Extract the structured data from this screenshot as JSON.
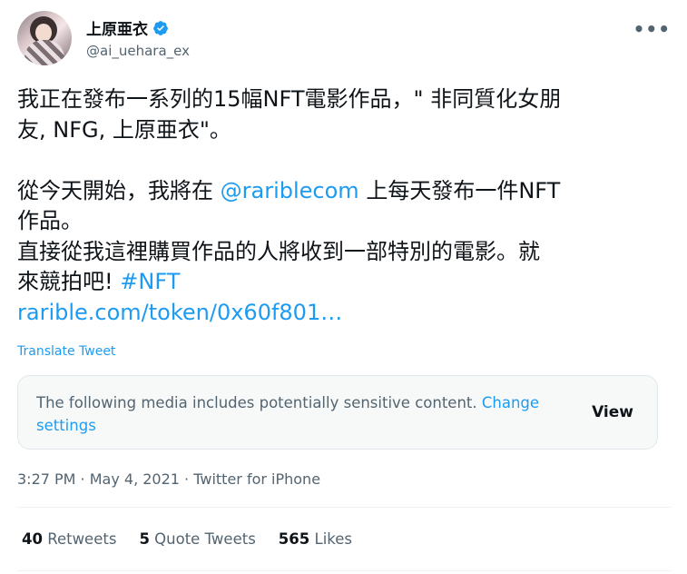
{
  "user": {
    "display_name": "上原亜衣",
    "handle": "@ai_uehara_ex",
    "verified": true
  },
  "tweet": {
    "line1": "我正在發布一系列的15幅NFT電影作品，\" 非同質化女朋",
    "line2": "友, NFG, 上原亜衣\"。",
    "line3_pre": "從今天開始，我將在 ",
    "mention": "@rariblecom",
    "line3_post": " 上每天發布一件NFT",
    "line4": "作品。",
    "line5": "直接從我這裡購買作品的人將收到一部特別的電影。就",
    "line6_pre": "來競拍吧! ",
    "hashtag": "#NFT",
    "url": "rarible.com/token/0x60f801…",
    "translate_label": "Translate Tweet"
  },
  "sensitive_notice": {
    "text": "The following media includes potentially sensitive content. ",
    "link": "Change settings",
    "view_label": "View"
  },
  "meta": {
    "time": "3:27 PM",
    "date": "May 4, 2021",
    "source": "Twitter for iPhone",
    "separator": " · "
  },
  "stats": {
    "retweets_count": "40",
    "retweets_label": "Retweets",
    "quotes_count": "5",
    "quotes_label": "Quote Tweets",
    "likes_count": "565",
    "likes_label": "Likes"
  },
  "icons": {
    "verified": "verified-badge-icon",
    "more": "more-dots-icon"
  },
  "colors": {
    "accent": "#1d9bf0",
    "text": "#0f1419",
    "secondary": "#536471"
  }
}
